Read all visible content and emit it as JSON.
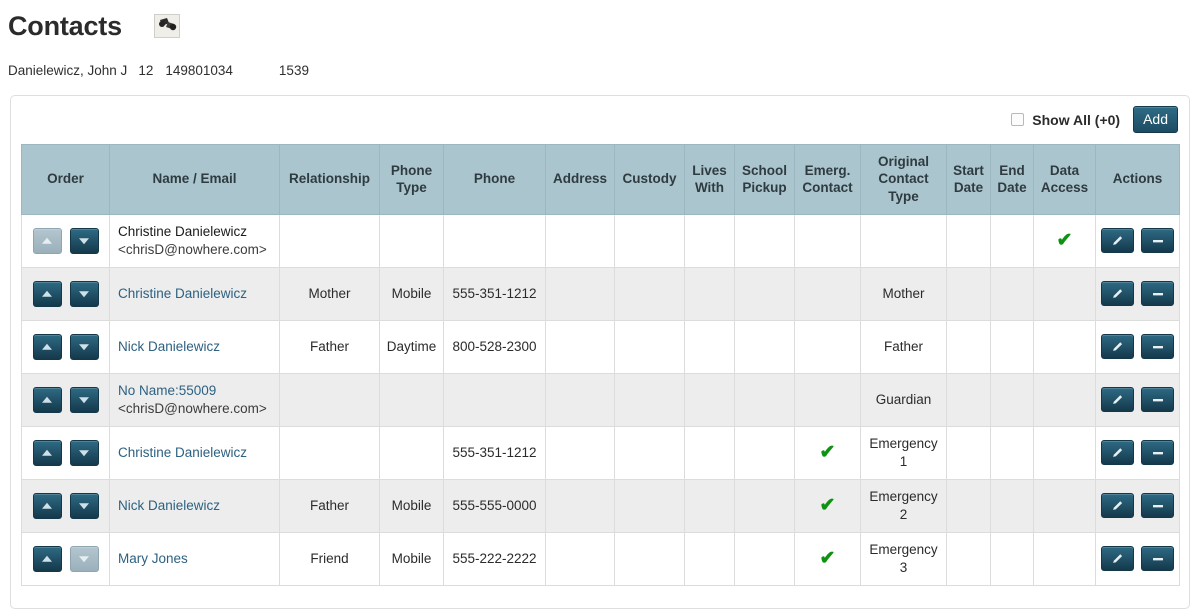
{
  "header": {
    "title": "Contacts",
    "title_icon": "binoculars-icon"
  },
  "student": {
    "name": "Danielewicz, John J",
    "grade": "12",
    "student_id": "149801034",
    "number": "1539"
  },
  "toolbar": {
    "show_all_label": "Show All (+0)",
    "show_all_checked": false,
    "add_label": "Add"
  },
  "table": {
    "columns": [
      "Order",
      "Name / Email",
      "Relationship",
      "Phone Type",
      "Phone",
      "Address",
      "Custody",
      "Lives With",
      "School Pickup",
      "Emerg. Contact",
      "Original Contact Type",
      "Start Date",
      "End Date",
      "Data Access",
      "Actions"
    ],
    "rows": [
      {
        "name": "Christine Danielewicz",
        "name_is_link": false,
        "email": "<chrisD@nowhere.com>",
        "relationship": "",
        "phone_type": "",
        "phone": "",
        "address": "",
        "custody": "",
        "lives_with": "",
        "school_pickup": "",
        "emerg_contact": false,
        "original_contact_type": "",
        "start_date": "",
        "end_date": "",
        "data_access": true,
        "up_disabled": true,
        "down_disabled": false
      },
      {
        "name": "Christine Danielewicz",
        "name_is_link": true,
        "email": "",
        "relationship": "Mother",
        "phone_type": "Mobile",
        "phone": "555-351-1212",
        "address": "",
        "custody": "",
        "lives_with": "",
        "school_pickup": "",
        "emerg_contact": false,
        "original_contact_type": "Mother",
        "start_date": "",
        "end_date": "",
        "data_access": false,
        "up_disabled": false,
        "down_disabled": false
      },
      {
        "name": "Nick Danielewicz",
        "name_is_link": true,
        "email": "",
        "relationship": "Father",
        "phone_type": "Daytime",
        "phone": "800-528-2300",
        "address": "",
        "custody": "",
        "lives_with": "",
        "school_pickup": "",
        "emerg_contact": false,
        "original_contact_type": "Father",
        "start_date": "",
        "end_date": "",
        "data_access": false,
        "up_disabled": false,
        "down_disabled": false
      },
      {
        "name": "No Name:55009",
        "name_is_link": true,
        "email": "<chrisD@nowhere.com>",
        "relationship": "",
        "phone_type": "",
        "phone": "",
        "address": "",
        "custody": "",
        "lives_with": "",
        "school_pickup": "",
        "emerg_contact": false,
        "original_contact_type": "Guardian",
        "start_date": "",
        "end_date": "",
        "data_access": false,
        "up_disabled": false,
        "down_disabled": false
      },
      {
        "name": "Christine Danielewicz",
        "name_is_link": true,
        "email": "",
        "relationship": "",
        "phone_type": "",
        "phone": "555-351-1212",
        "address": "",
        "custody": "",
        "lives_with": "",
        "school_pickup": "",
        "emerg_contact": true,
        "original_contact_type": "Emergency 1",
        "start_date": "",
        "end_date": "",
        "data_access": false,
        "up_disabled": false,
        "down_disabled": false
      },
      {
        "name": "Nick Danielewicz",
        "name_is_link": true,
        "email": "",
        "relationship": "Father",
        "phone_type": "Mobile",
        "phone": "555-555-0000",
        "address": "",
        "custody": "",
        "lives_with": "",
        "school_pickup": "",
        "emerg_contact": true,
        "original_contact_type": "Emergency 2",
        "start_date": "",
        "end_date": "",
        "data_access": false,
        "up_disabled": false,
        "down_disabled": false
      },
      {
        "name": "Mary Jones",
        "name_is_link": true,
        "email": "",
        "relationship": "Friend",
        "phone_type": "Mobile",
        "phone": "555-222-2222",
        "address": "",
        "custody": "",
        "lives_with": "",
        "school_pickup": "",
        "emerg_contact": true,
        "original_contact_type": "Emergency 3",
        "start_date": "",
        "end_date": "",
        "data_access": false,
        "up_disabled": false,
        "down_disabled": true
      }
    ],
    "row_actions": {
      "edit": "edit-pencil-icon",
      "remove": "remove-minus-icon"
    },
    "order_actions": {
      "up": "arrow-up-icon",
      "down": "arrow-down-icon"
    },
    "check_glyph": "✔"
  },
  "colors": {
    "header_bg": "#abc5ce",
    "button_dark": "#1d4c63",
    "link": "#2d6181",
    "check_green": "#0f9212",
    "row_alt": "#ededed"
  }
}
